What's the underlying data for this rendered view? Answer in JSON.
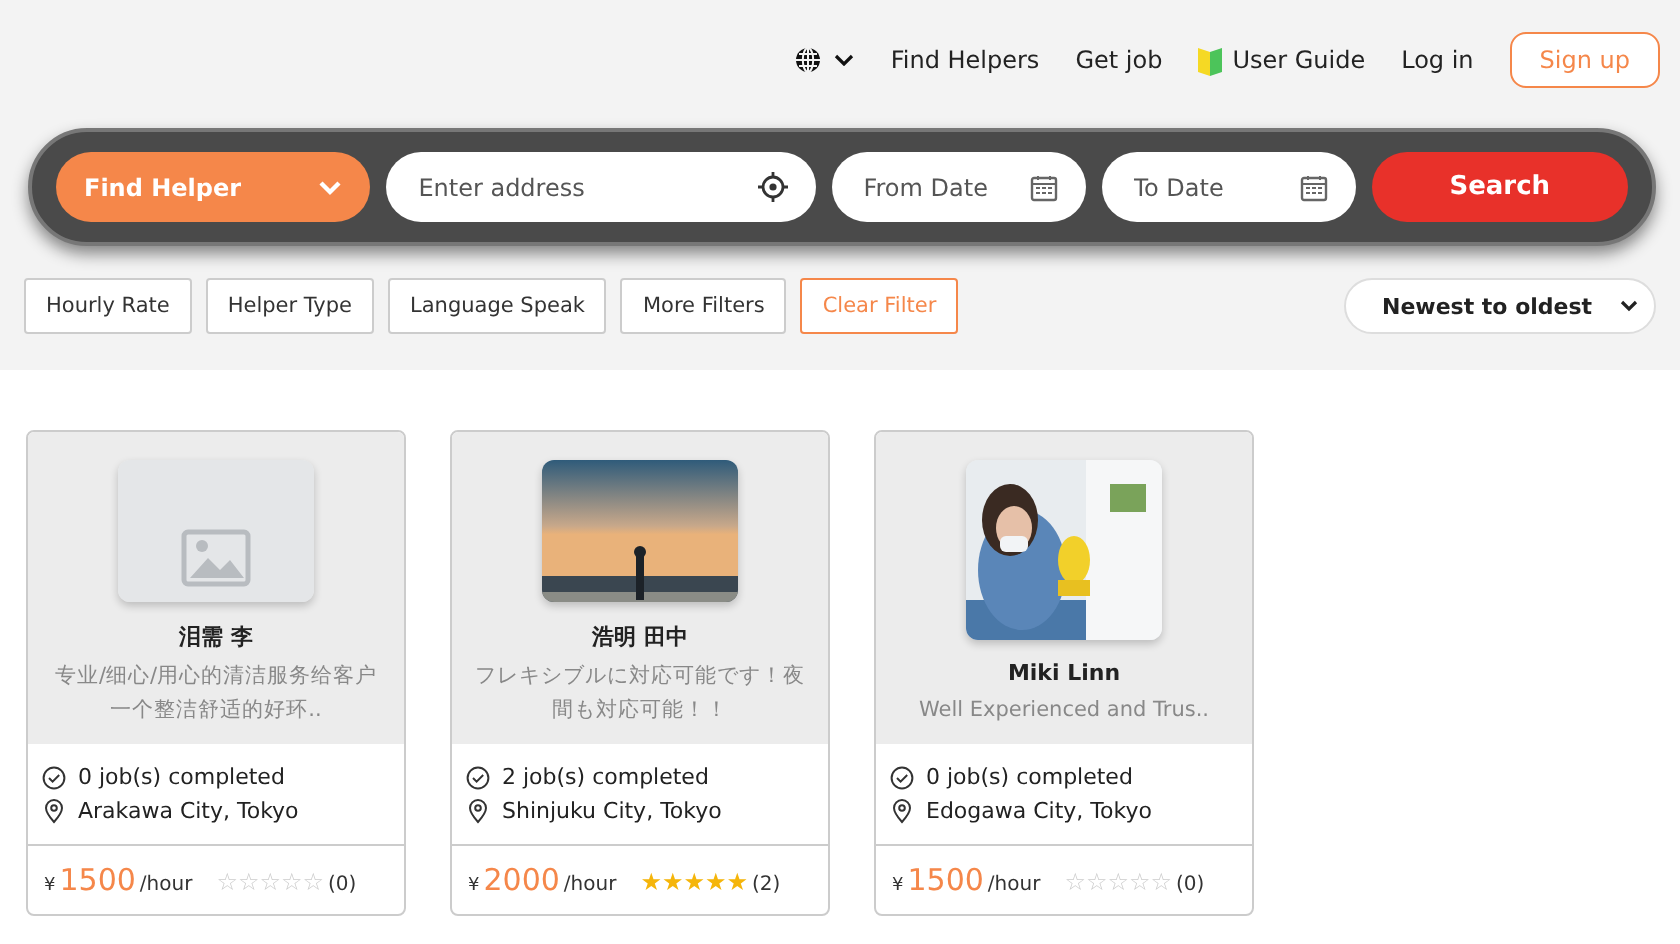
{
  "nav": {
    "links": [
      "Find Helpers",
      "Get job",
      "User Guide",
      "Log in"
    ],
    "signup": "Sign up"
  },
  "search": {
    "category": "Find Helper",
    "address": {
      "placeholder": "Enter address"
    },
    "from": {
      "placeholder": "From Date"
    },
    "to": {
      "placeholder": "To Date"
    },
    "button": "Search"
  },
  "filters": [
    {
      "label": "Hourly Rate",
      "kind": "plain"
    },
    {
      "label": "Helper Type",
      "kind": "plain"
    },
    {
      "label": "Language Speak",
      "kind": "plain"
    },
    {
      "label": "More Filters",
      "kind": "plain"
    },
    {
      "label": "Clear Filter",
      "kind": "clear"
    }
  ],
  "sort": "Newest to oldest",
  "helpers": [
    {
      "name": "泪需 李",
      "bio": "专业/细心/用心的清洁服务给客户一个整洁舒适的好环..",
      "kind": "placeholder",
      "jobs": "0 job(s) completed",
      "location": "Arakawa City, Tokyo",
      "currency": "¥",
      "price": "1500",
      "unit": "/hour",
      "stars": 0,
      "reviews": "(0)"
    },
    {
      "name": "浩明 田中",
      "bio": "フレキシブルに対応可能です！夜間も対応可能！！",
      "kind": "picture",
      "jobs": "2 job(s) completed",
      "location": "Shinjuku City, Tokyo",
      "currency": "¥",
      "price": "2000",
      "unit": "/hour",
      "stars": 5,
      "reviews": "(2)"
    },
    {
      "name": "Miki Linn",
      "bio": "Well Experienced and Trus..",
      "kind": "picture",
      "jobs": "0 job(s) completed",
      "location": "Edogawa City, Tokyo",
      "currency": "¥",
      "price": "1500",
      "unit": "/hour",
      "stars": 0,
      "reviews": "(0)"
    }
  ]
}
